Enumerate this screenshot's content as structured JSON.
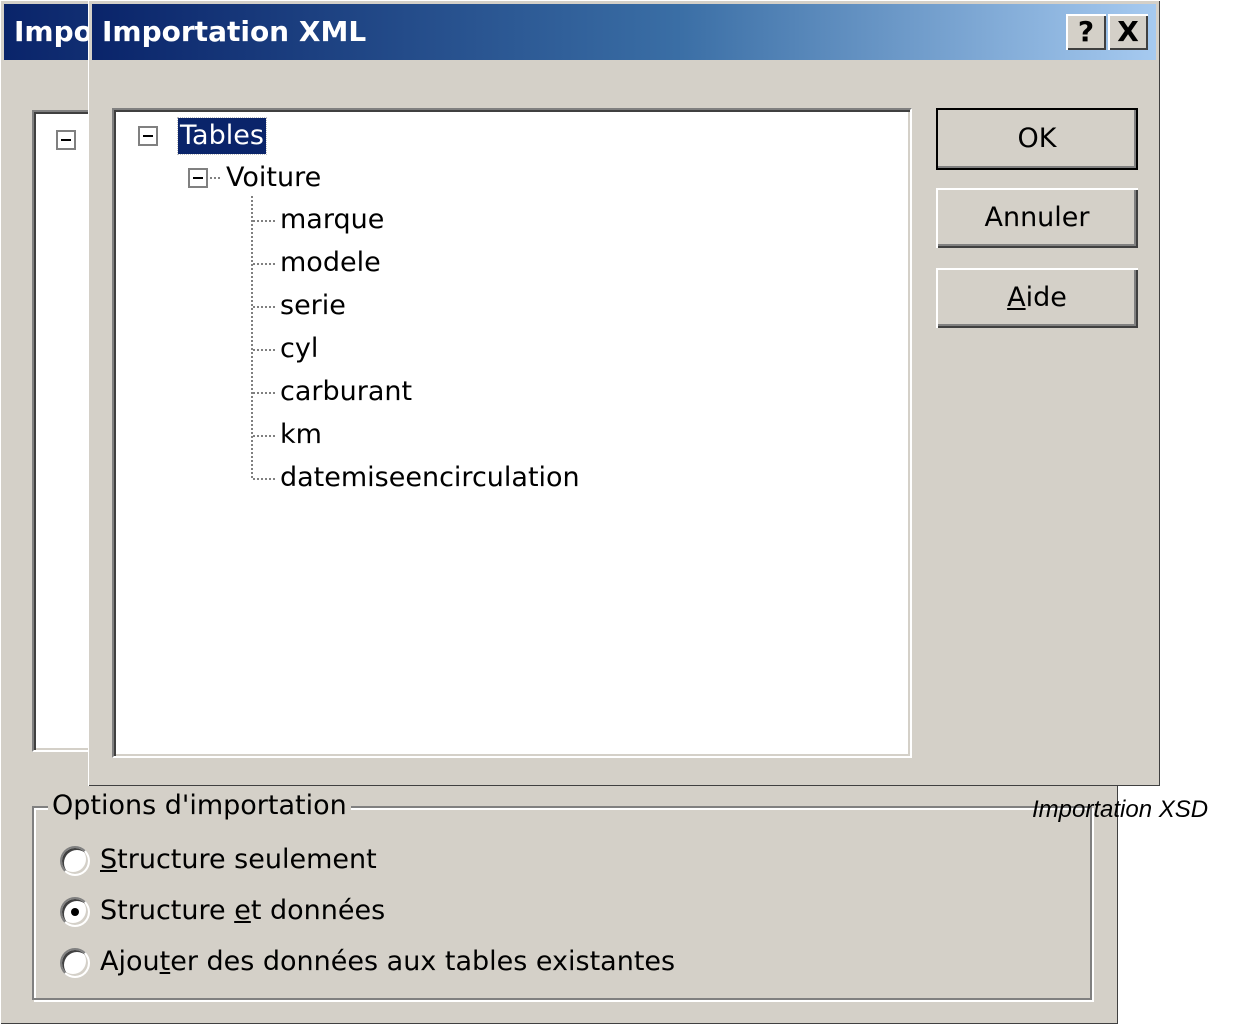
{
  "back_dialog": {
    "title": "Importation XSD",
    "options_group_label": "Options d'importation",
    "radio_options": [
      {
        "pre": "",
        "key": "S",
        "post": "tructure seulement",
        "checked": false
      },
      {
        "pre": "Structure ",
        "key": "e",
        "post": "t données",
        "checked": true
      },
      {
        "pre": "Ajou",
        "key": "t",
        "post": "er des données aux tables existantes",
        "checked": false
      }
    ]
  },
  "front_dialog": {
    "title": "Importation XML",
    "help_button": "?",
    "close_button": "X",
    "tree": {
      "root": "Tables",
      "table": "Voiture",
      "fields": [
        "marque",
        "modele",
        "serie",
        "cyl",
        "carburant",
        "km",
        "datemiseencirculation"
      ]
    },
    "buttons": {
      "ok": "OK",
      "cancel": "Annuler",
      "help_key": "A",
      "help_rest": "ide"
    }
  },
  "caption": "Importation XSD"
}
